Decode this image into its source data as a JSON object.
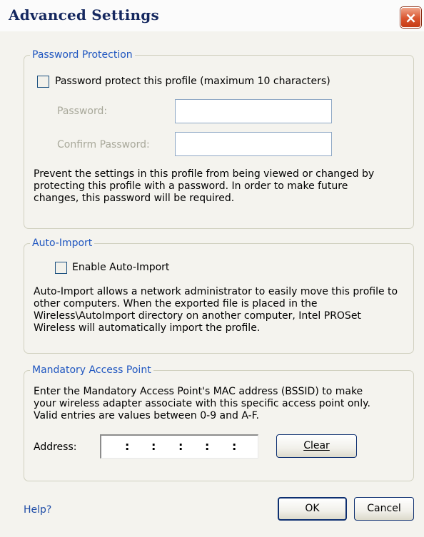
{
  "window": {
    "title": "Advanced Settings",
    "close_glyph": "×"
  },
  "password_group": {
    "legend": "Password Protection",
    "checkbox_label": "Password protect this profile (maximum 10 characters)",
    "checkbox_checked": false,
    "password_label": "Password:",
    "password_value": "",
    "confirm_label": "Confirm Password:",
    "confirm_value": "",
    "description_lines": [
      "Prevent the settings in this profile from being viewed or changed by",
      "protecting this profile with a password. In order to make future",
      "changes, this password will be required."
    ]
  },
  "auto_import_group": {
    "legend": "Auto-Import",
    "checkbox_label": "Enable Auto-Import",
    "checkbox_checked": false,
    "description_lines": [
      "Auto-Import allows a network administrator to easily move this profile to",
      "other computers. When the exported file is placed in the",
      "Wireless\\AutoImport directory on another computer, Intel PROSet",
      "Wireless will automatically import the profile."
    ]
  },
  "map_group": {
    "legend": "Mandatory Access Point",
    "description_lines": [
      "Enter the Mandatory Access Point's MAC address (BSSID) to make",
      "your wireless adapter associate with this specific access point only.",
      "Valid entries are values between 0-9 and A-F."
    ],
    "address_label": "Address:",
    "address_separator": ":",
    "clear_label": "Clear"
  },
  "footer": {
    "help": "Help?",
    "ok": "OK",
    "cancel": "Cancel"
  },
  "colors": {
    "legend": "#1f56c0",
    "link": "#1d4ba6",
    "title": "#15285f",
    "close": "#d9542d"
  }
}
